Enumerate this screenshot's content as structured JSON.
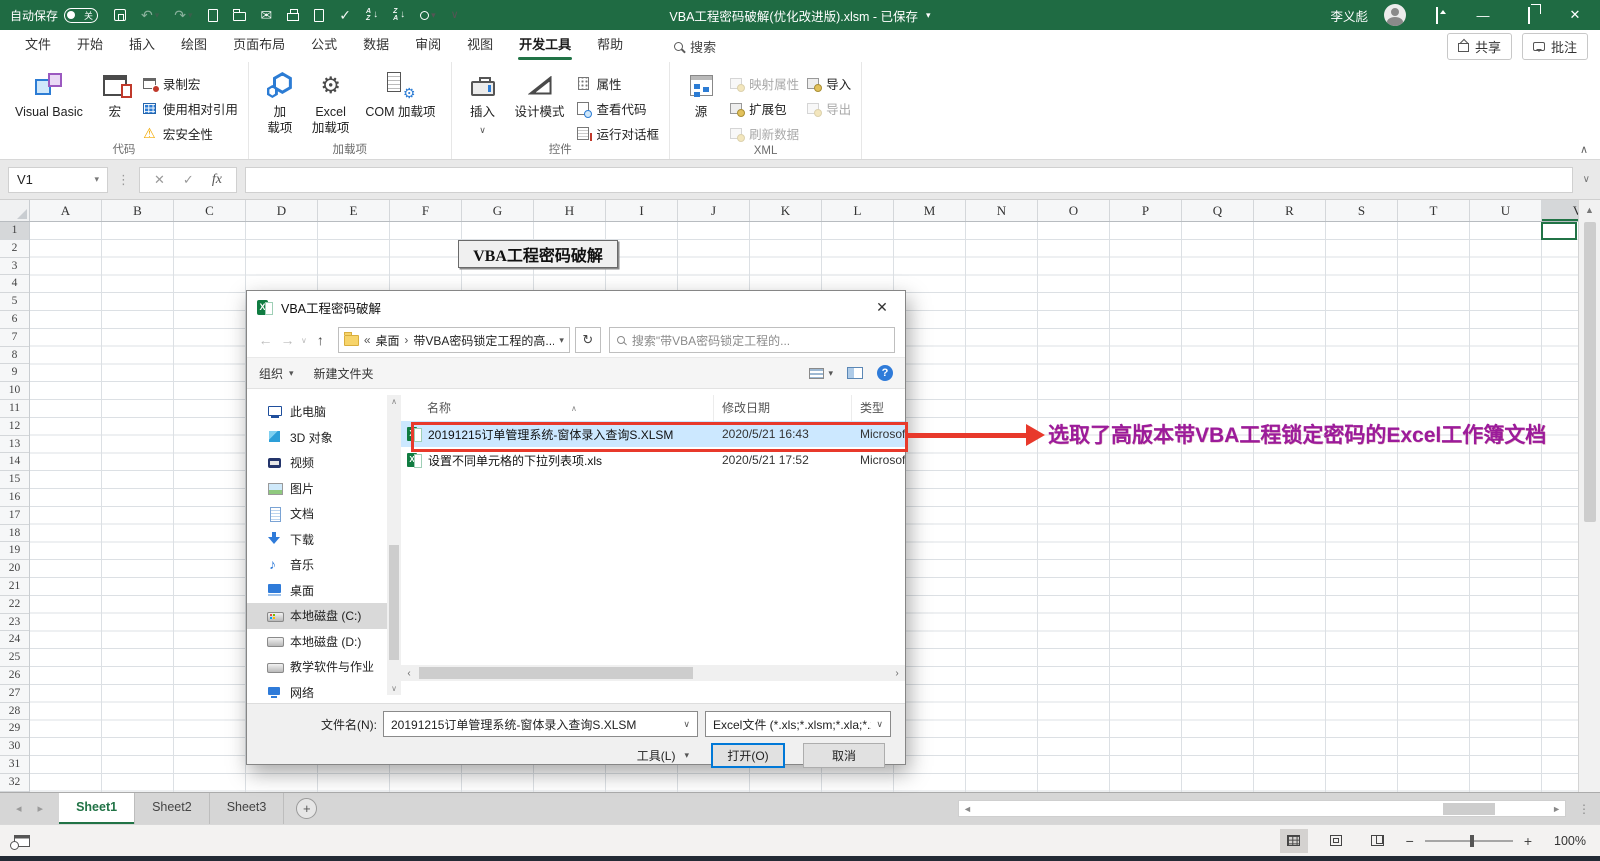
{
  "colors": {
    "accent_green": "#217346",
    "titlebar_green": "#1f6b43",
    "selection_blue": "#cce8ff",
    "annotation_red": "#e8392b",
    "annotation_purple": "#9b1b9b",
    "default_button_blue": "#0078d7"
  },
  "icons": {
    "close": "✕",
    "minimize": "—",
    "dropdown": "▾",
    "chevron_up": "∧",
    "chevron_down": "∨",
    "back": "←",
    "forward": "→",
    "up": "↑",
    "refresh": "↻",
    "undo": "↶",
    "redo": "↷",
    "mail": "✉",
    "check": "✓",
    "warning": "⚠",
    "gear": "⚙",
    "fx": "fx",
    "breadcrumb_chevrons": "«",
    "breadcrumb_sep": "›",
    "scroll_left": "◄",
    "scroll_right": "►",
    "small_left": "‹",
    "small_right": "›",
    "tri_left": "◂",
    "tri_right": "▸",
    "tri_up": "▲",
    "plus": "+",
    "minus": "−",
    "ellipsis": "⋮",
    "down_arrow": "↓"
  },
  "titlebar": {
    "autosave_label": "自动保存",
    "autosave_state": "关",
    "title": "VBA工程密码破解(优化改进版).xlsm - 已保存",
    "user_name": "李义彪"
  },
  "ribbon_tabs": {
    "items": [
      {
        "id": "file",
        "label": "文件"
      },
      {
        "id": "home",
        "label": "开始"
      },
      {
        "id": "insert",
        "label": "插入"
      },
      {
        "id": "draw",
        "label": "绘图"
      },
      {
        "id": "page-layout",
        "label": "页面布局"
      },
      {
        "id": "formulas",
        "label": "公式"
      },
      {
        "id": "data",
        "label": "数据"
      },
      {
        "id": "review",
        "label": "审阅"
      },
      {
        "id": "view",
        "label": "视图"
      },
      {
        "id": "developer",
        "label": "开发工具"
      },
      {
        "id": "help",
        "label": "帮助"
      }
    ],
    "active": "developer",
    "search_label": "搜索",
    "share_label": "共享",
    "comments_label": "批注"
  },
  "ribbon": {
    "code_group": {
      "label": "代码",
      "visual_basic": "Visual Basic",
      "macros": "宏",
      "record_macro": "录制宏",
      "use_relative_references": "使用相对引用",
      "macro_security": "宏安全性"
    },
    "addins_group": {
      "label": "加载项",
      "addins": "加\n载项",
      "excel_addins": "Excel\n加载项",
      "com_addins": "COM 加载项"
    },
    "controls_group": {
      "label": "控件",
      "insert": "插入",
      "design_mode": "设计模式",
      "properties": "属性",
      "view_code": "查看代码",
      "run_dialog": "运行对话框"
    },
    "xml_group": {
      "label": "XML",
      "source": "源",
      "map_properties": "映射属性",
      "expansion_packs": "扩展包",
      "refresh_data": "刷新数据",
      "import": "导入",
      "export": "导出"
    }
  },
  "formula_bar": {
    "name_box": "V1",
    "formula_value": ""
  },
  "grid": {
    "columns": [
      "A",
      "B",
      "C",
      "D",
      "E",
      "F",
      "G",
      "H",
      "I",
      "J",
      "K",
      "L",
      "M",
      "N",
      "O",
      "P",
      "Q",
      "R",
      "S",
      "T",
      "U",
      "V"
    ],
    "row_count": 32,
    "selected_column": "V",
    "selected_row": 1,
    "selected_cell": "V1",
    "button_label": "VBA工程密码破解"
  },
  "dialog": {
    "title": "VBA工程密码破解",
    "breadcrumb": {
      "chevrons": "«",
      "root": "桌面",
      "sep": "›",
      "folder": "带VBA密码锁定工程的高..."
    },
    "search_text": "搜索\"带VBA密码锁定工程的...",
    "toolbar": {
      "organize_label": "组织",
      "new_folder_label": "新建文件夹"
    },
    "list_headers": {
      "name": "名称",
      "date": "修改日期",
      "type": "类型"
    },
    "tree": [
      {
        "id": "this-pc",
        "icon": "computer",
        "label": "此电脑"
      },
      {
        "id": "3d-objects",
        "icon": "cube",
        "label": "3D 对象"
      },
      {
        "id": "videos",
        "icon": "video",
        "label": "视频"
      },
      {
        "id": "pictures",
        "icon": "picture",
        "label": "图片"
      },
      {
        "id": "documents",
        "icon": "document",
        "label": "文档"
      },
      {
        "id": "downloads",
        "icon": "download",
        "label": "下载"
      },
      {
        "id": "music",
        "icon": "music",
        "label": "音乐"
      },
      {
        "id": "desktop",
        "icon": "desktop",
        "label": "桌面"
      },
      {
        "id": "disk-c",
        "icon": "disk-win",
        "label": "本地磁盘 (C:)",
        "selected": true
      },
      {
        "id": "disk-d",
        "icon": "disk",
        "label": "本地磁盘 (D:)"
      },
      {
        "id": "disk-edu",
        "icon": "disk",
        "label": "教学软件与作业"
      },
      {
        "id": "network",
        "icon": "network",
        "label": "网络"
      }
    ],
    "files": [
      {
        "name": "20191215订单管理系统-窗体录入查询S.XLSM",
        "date": "2020/5/21 16:43",
        "type": "Microsoft E",
        "selected": true
      },
      {
        "name": "设置不同单元格的下拉列表项.xls",
        "date": "2020/5/21 17:52",
        "type": "Microsoft E",
        "selected": false
      }
    ],
    "footer": {
      "filename_label": "文件名(N):",
      "filename_value": "20191215订单管理系统-窗体录入查询S.XLSM",
      "filetype_value": "Excel文件 (*.xls;*.xlsm;*.xla;*.x",
      "tools_label": "工具(L)",
      "open_label": "打开(O)",
      "cancel_label": "取消"
    }
  },
  "annotation": {
    "text": "选取了高版本带VBA工程锁定密码的Excel工作簿文档"
  },
  "sheet_bar": {
    "tabs": [
      {
        "id": "sheet1",
        "label": "Sheet1",
        "active": true
      },
      {
        "id": "sheet2",
        "label": "Sheet2",
        "active": false
      },
      {
        "id": "sheet3",
        "label": "Sheet3",
        "active": false
      }
    ]
  },
  "status_bar": {
    "zoom_level": "100%"
  }
}
